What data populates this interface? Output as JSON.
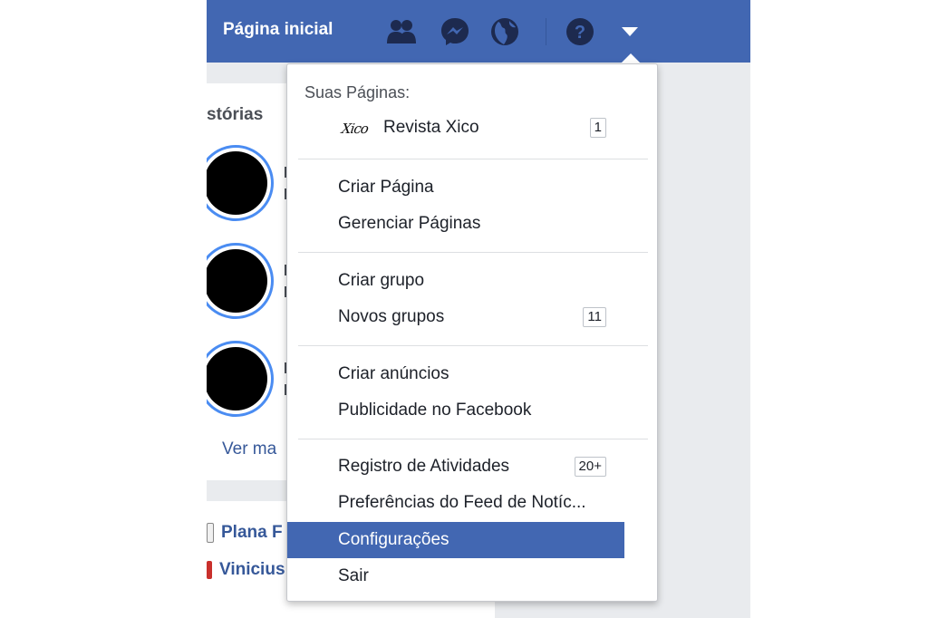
{
  "topbar": {
    "home_label": "Página inicial",
    "icons": [
      "friends-icon",
      "messenger-icon",
      "globe-icon",
      "help-icon",
      "dropdown-arrow-icon"
    ],
    "bg_color": "#4267b2"
  },
  "left_panel": {
    "stories_title": "stórias",
    "see_more": "Ver ma",
    "feed_items": [
      {
        "name": "Plana F"
      },
      {
        "name": "Vinicius"
      }
    ]
  },
  "menu": {
    "header": "Suas Páginas:",
    "page_item": {
      "logo_text": "Xico",
      "label": "Revista Xico",
      "badge": "1"
    },
    "items": [
      {
        "label": "Criar Página"
      },
      {
        "label": "Gerenciar Páginas"
      },
      {
        "label": "Criar grupo"
      },
      {
        "label": "Novos grupos",
        "badge": "11"
      },
      {
        "label": "Criar anúncios"
      },
      {
        "label": "Publicidade no Facebook"
      },
      {
        "label": "Registro de Atividades",
        "badge": "20+"
      },
      {
        "label": "Preferências do Feed de Notíc..."
      },
      {
        "label": "Configurações",
        "selected": true
      },
      {
        "label": "Sair"
      }
    ],
    "selected_color": "#4267b2"
  }
}
